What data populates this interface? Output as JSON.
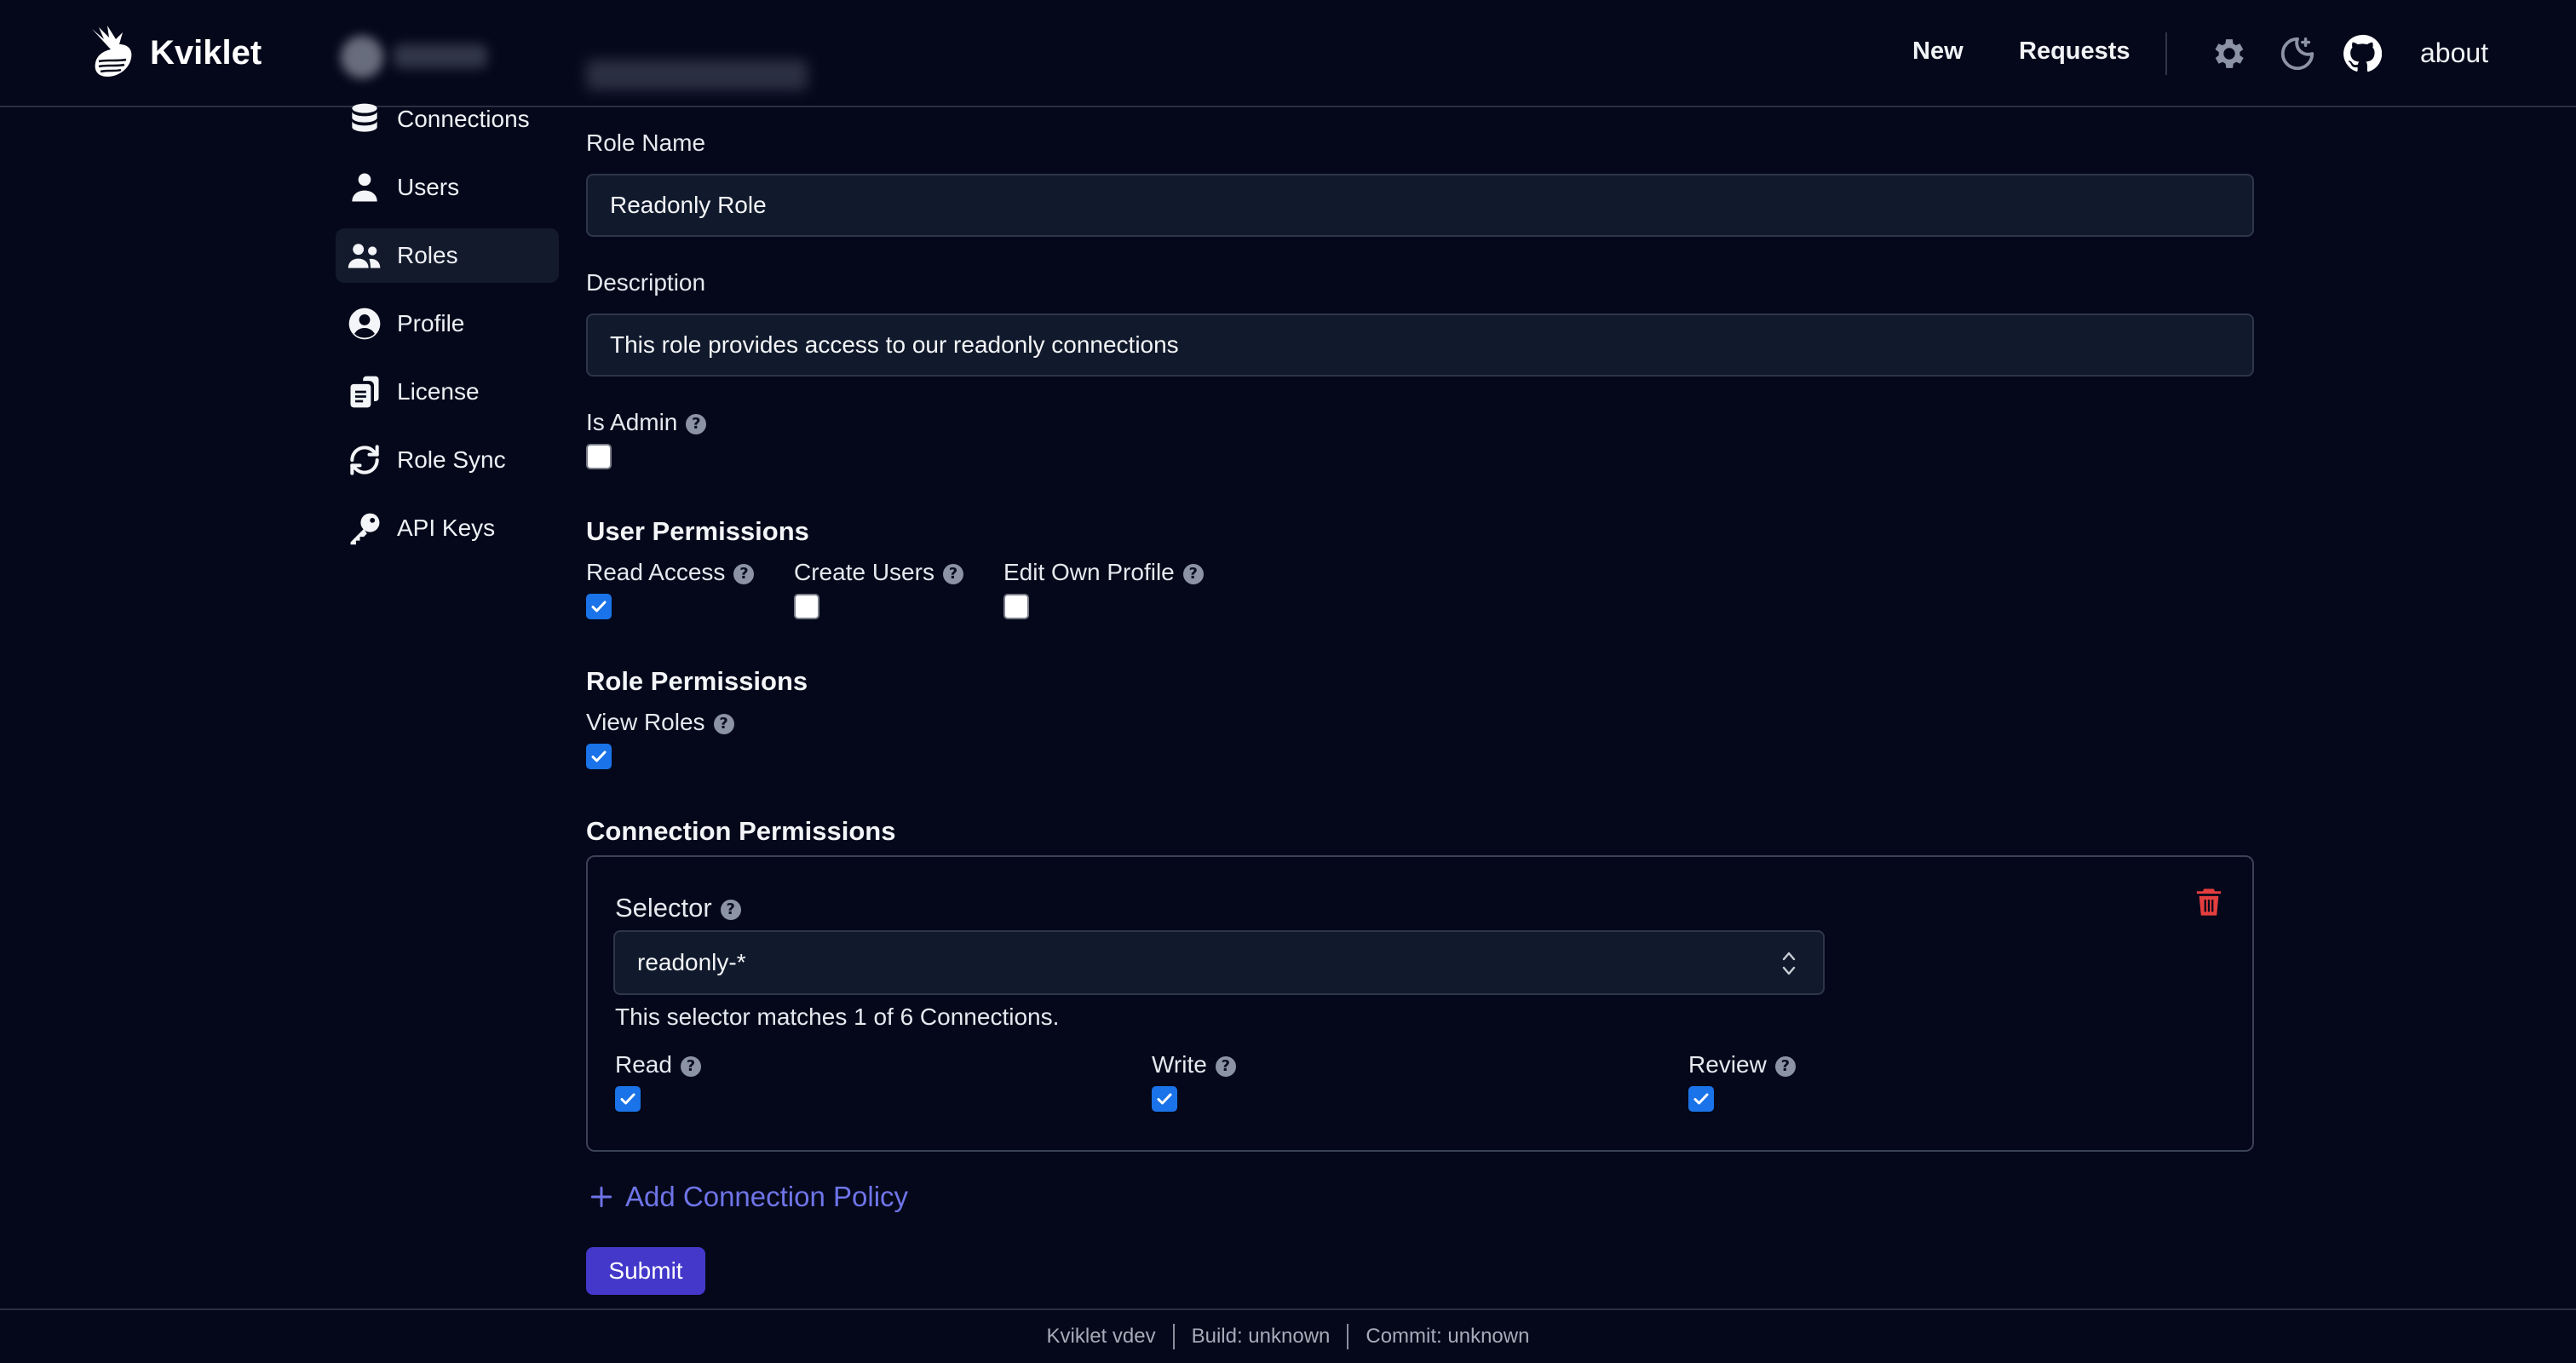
{
  "header": {
    "app_name": "Kviklet",
    "nav": {
      "new": "New",
      "requests": "Requests",
      "about": "about"
    },
    "icons": [
      "settings-gear-icon",
      "theme-moon-icon",
      "github-icon"
    ]
  },
  "sidebar": {
    "items": [
      {
        "label": "Connections",
        "icon": "database-icon",
        "active": false
      },
      {
        "label": "Users",
        "icon": "user-icon",
        "active": false
      },
      {
        "label": "Roles",
        "icon": "users-group-icon",
        "active": true
      },
      {
        "label": "Profile",
        "icon": "user-circle-icon",
        "active": false
      },
      {
        "label": "License",
        "icon": "license-icon",
        "active": false
      },
      {
        "label": "Role Sync",
        "icon": "sync-icon",
        "active": false
      },
      {
        "label": "API Keys",
        "icon": "key-icon",
        "active": false
      }
    ]
  },
  "form": {
    "role_name_label": "Role Name",
    "role_name_value": "Readonly Role",
    "description_label": "Description",
    "description_value": "This role provides access to our readonly connections",
    "is_admin_label": "Is Admin",
    "is_admin_checked": false,
    "user_permissions": {
      "title": "User Permissions",
      "read_access": {
        "label": "Read Access",
        "checked": true
      },
      "create_users": {
        "label": "Create Users",
        "checked": false
      },
      "edit_own_profile": {
        "label": "Edit Own Profile",
        "checked": false
      }
    },
    "role_permissions": {
      "title": "Role Permissions",
      "view_roles": {
        "label": "View Roles",
        "checked": true
      }
    },
    "connection_permissions": {
      "title": "Connection Permissions",
      "policy": {
        "selector_label": "Selector",
        "selector_value": "readonly-*",
        "match_text": "This selector matches 1 of 6 Connections.",
        "read": {
          "label": "Read",
          "checked": true
        },
        "write": {
          "label": "Write",
          "checked": true
        },
        "review": {
          "label": "Review",
          "checked": true
        }
      }
    },
    "add_policy_label": "Add Connection Policy",
    "submit_label": "Submit"
  },
  "footer": {
    "version": "Kviklet vdev",
    "build": "Build: unknown",
    "commit": "Commit: unknown"
  },
  "colors": {
    "background": "#04081a",
    "accent": "#4338ca",
    "link": "#6f74e8",
    "checkbox": "#1a73e8",
    "danger": "#e53e3e"
  }
}
